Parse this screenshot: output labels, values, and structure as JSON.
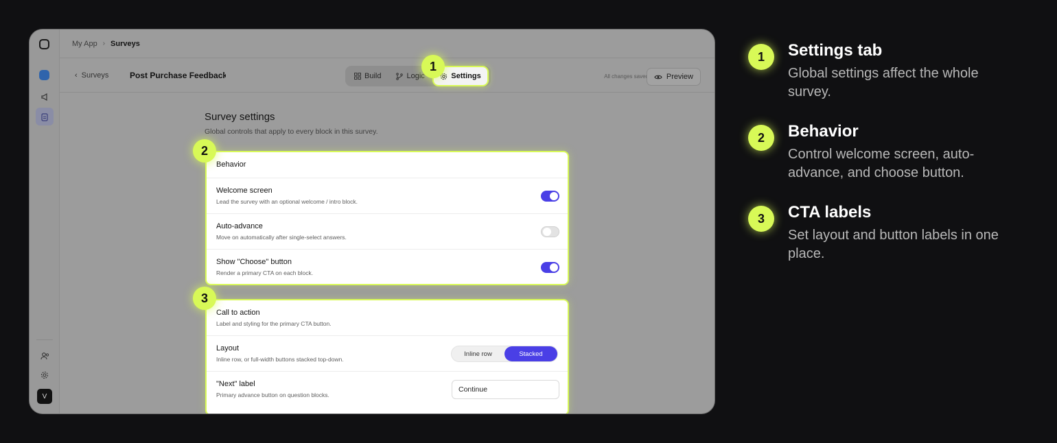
{
  "breadcrumb": {
    "root": "My App",
    "current": "Surveys"
  },
  "rail": {
    "avatar_initial": "V"
  },
  "toolbar": {
    "back_label": "Surveys",
    "survey_title": "Post Purchase Feedback S",
    "tabs": [
      {
        "label": "Build",
        "icon": "grid-icon"
      },
      {
        "label": "Logic",
        "icon": "branch-icon"
      },
      {
        "label": "Settings",
        "icon": "gear-icon",
        "active": true
      }
    ],
    "saved_status": "All changes saved",
    "preview_label": "Preview"
  },
  "settings": {
    "title": "Survey settings",
    "subtitle": "Global controls that apply to every block in this survey."
  },
  "behavior": {
    "header": "Behavior",
    "rows": [
      {
        "title": "Welcome screen",
        "desc": "Lead the survey with an optional welcome / intro block.",
        "enabled": true
      },
      {
        "title": "Auto-advance",
        "desc": "Move on automatically after single-select answers.",
        "enabled": false
      },
      {
        "title": "Show \"Choose\" button",
        "desc": "Render a primary CTA on each block.",
        "enabled": true
      }
    ]
  },
  "cta": {
    "header": "Call to action",
    "header_desc": "Label and styling for the primary CTA button.",
    "layout": {
      "title": "Layout",
      "desc": "Inline row, or full-width buttons stacked top-down.",
      "options": [
        "Inline row",
        "Stacked"
      ],
      "selected": "Stacked"
    },
    "next_label": {
      "title": "\"Next\" label",
      "desc": "Primary advance button on question blocks.",
      "value": "Continue"
    }
  },
  "markers": [
    "1",
    "2",
    "3"
  ],
  "callouts": [
    {
      "num": "1",
      "title": "Settings tab",
      "desc": "Global settings affect the whole survey."
    },
    {
      "num": "2",
      "title": "Behavior",
      "desc": "Control welcome screen, auto-advance, and choose button."
    },
    {
      "num": "3",
      "title": "CTA labels",
      "desc": "Set layout and button labels in one place."
    }
  ],
  "colors": {
    "accent": "#d8f957",
    "primary": "#4a3fe6",
    "background": "#101012"
  }
}
